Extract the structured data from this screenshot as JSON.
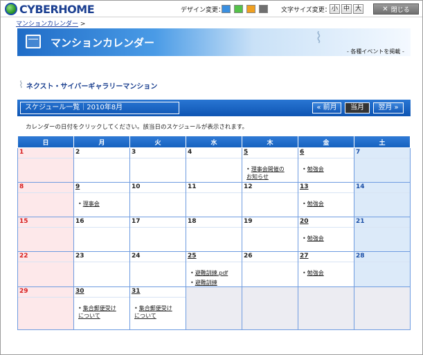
{
  "header": {
    "logo_text": "CYBERHOME",
    "design_label": "デザイン変更：",
    "font_size_label": "文字サイズ変更：",
    "font_sizes": [
      "小",
      "中",
      "大"
    ],
    "close_label": "閉じる",
    "swatch_colors": [
      "#3a8fe0",
      "#55c24a",
      "#f0a020",
      "#6f6f6f"
    ]
  },
  "breadcrumb": {
    "link": "マンションカレンダー",
    "separator": ">"
  },
  "banner": {
    "title": "マンションカレンダー",
    "subtitle": "- 各種イベントを掲載 -"
  },
  "building": {
    "name": "ネクスト・サイバーギャラリーマンション"
  },
  "schedule": {
    "title": "スケジュール一覧｜2010年8月",
    "prev_label": "« 前月",
    "current_label": "当月",
    "next_label": "翌月 »"
  },
  "instruction": "カレンダーの日付をクリックしてください。該当日のスケジュールが表示されます。",
  "calendar": {
    "weekdays": [
      "日",
      "月",
      "火",
      "水",
      "木",
      "金",
      "土"
    ],
    "weeks": [
      [
        {
          "day": "1",
          "events": []
        },
        {
          "day": "2",
          "events": []
        },
        {
          "day": "3",
          "events": []
        },
        {
          "day": "4",
          "events": []
        },
        {
          "day": "5",
          "events": [
            "理事会開催の",
            "お知らせ"
          ],
          "linked": true,
          "multiline": true
        },
        {
          "day": "6",
          "events": [
            "勉強会"
          ],
          "linked": true
        },
        {
          "day": "7",
          "events": []
        }
      ],
      [
        {
          "day": "8",
          "events": []
        },
        {
          "day": "9",
          "events": [
            "理事会"
          ],
          "linked": true
        },
        {
          "day": "10",
          "events": []
        },
        {
          "day": "11",
          "events": []
        },
        {
          "day": "12",
          "events": []
        },
        {
          "day": "13",
          "events": [
            "勉強会"
          ],
          "linked": true
        },
        {
          "day": "14",
          "events": []
        }
      ],
      [
        {
          "day": "15",
          "events": []
        },
        {
          "day": "16",
          "events": []
        },
        {
          "day": "17",
          "events": []
        },
        {
          "day": "18",
          "events": []
        },
        {
          "day": "19",
          "events": []
        },
        {
          "day": "20",
          "events": [
            "勉強会"
          ],
          "linked": true
        },
        {
          "day": "21",
          "events": []
        }
      ],
      [
        {
          "day": "22",
          "events": []
        },
        {
          "day": "23",
          "events": []
        },
        {
          "day": "24",
          "events": []
        },
        {
          "day": "25",
          "events": [
            "避難訓練.pdf",
            "避難訓練"
          ],
          "linked": true
        },
        {
          "day": "26",
          "events": []
        },
        {
          "day": "27",
          "events": [
            "勉強会"
          ],
          "linked": true
        },
        {
          "day": "28",
          "events": []
        }
      ],
      [
        {
          "day": "29",
          "events": []
        },
        {
          "day": "30",
          "events": [
            "集合郵便受け",
            "について"
          ],
          "linked": true,
          "multiline": true
        },
        {
          "day": "31",
          "events": [
            "集合郵便受け",
            "について"
          ],
          "linked": true,
          "multiline": true
        },
        {
          "day": "",
          "events": []
        },
        {
          "day": "",
          "events": []
        },
        {
          "day": "",
          "events": []
        },
        {
          "day": "",
          "events": []
        }
      ]
    ]
  }
}
